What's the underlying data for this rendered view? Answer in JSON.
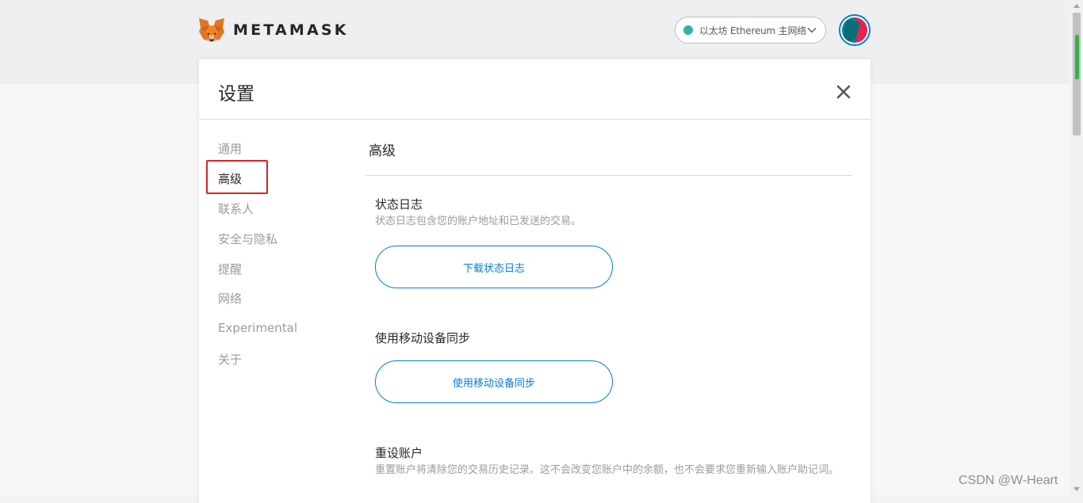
{
  "header": {
    "brand": "METAMASK",
    "network": {
      "label": "以太坊 Ethereum 主网络",
      "dot_color": "#29b6af"
    }
  },
  "settings": {
    "title": "设置",
    "sidebar": [
      {
        "label": "通用"
      },
      {
        "label": "高级"
      },
      {
        "label": "联系人"
      },
      {
        "label": "安全与隐私"
      },
      {
        "label": "提醒"
      },
      {
        "label": "网络"
      },
      {
        "label": "Experimental"
      },
      {
        "label": "关于"
      }
    ],
    "active_item": "高级",
    "content": {
      "title": "高级",
      "state_logs": {
        "title": "状态日志",
        "description": "状态日志包含您的账户地址和已发送的交易。",
        "button": "下载状态日志"
      },
      "mobile_sync": {
        "title": "使用移动设备同步",
        "button": "使用移动设备同步"
      },
      "reset_account": {
        "title": "重设账户",
        "description": "重置账户将清除您的交易历史记录。这不会改变您账户中的余额，也不会要求您重新输入账户助记词。"
      }
    }
  },
  "colors": {
    "accent": "#037dd6",
    "highlight_box": "#e02020",
    "scroll_marker": "#33b249"
  },
  "watermark": "CSDN @W-Heart"
}
